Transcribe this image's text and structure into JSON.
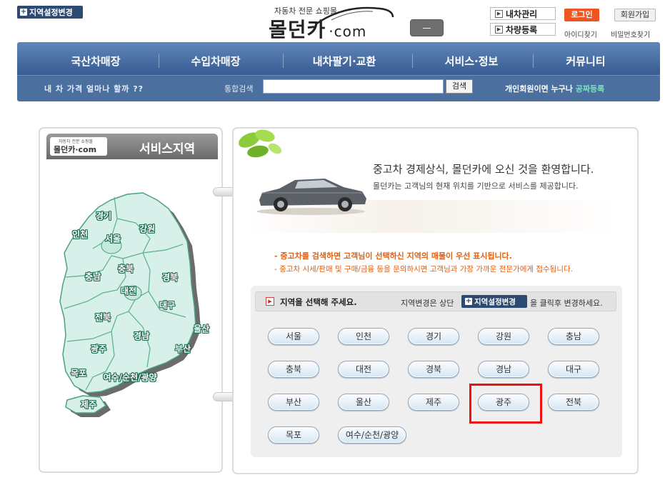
{
  "header": {
    "region_change_label": "지역설정변경",
    "logo_tagline": "자동차 전문 쇼핑몰",
    "logo_name": "몰던카",
    "logo_suffix": "·com",
    "logo_button": "—",
    "menu_my_car": "내차관리",
    "menu_register": "차량등록",
    "login": "로그인",
    "join": "회원가입",
    "find_id": "아이디찾기",
    "find_pw": "비밀번호찾기"
  },
  "nav": {
    "items": [
      "국산차매장",
      "수입차매장",
      "내차팔기·교환",
      "서비스·정보",
      "커뮤니티"
    ],
    "promo_left": "내 차 가격 얼마나 할까 ??",
    "search_label": "통합검색",
    "search_value": "",
    "search_button": "검색",
    "promo_right_prefix": "개인회원이면 누구나",
    "promo_right_highlight": "공짜등록"
  },
  "service": {
    "logo_tagline": "자동차 전문 쇼핑몰",
    "logo_name": "몰던카·com",
    "title": "서비스지역"
  },
  "map_regions": [
    {
      "name": "경기"
    },
    {
      "name": "인천"
    },
    {
      "name": "서울"
    },
    {
      "name": "강원"
    },
    {
      "name": "충남"
    },
    {
      "name": "충북"
    },
    {
      "name": "대전"
    },
    {
      "name": "경북"
    },
    {
      "name": "대구"
    },
    {
      "name": "전북"
    },
    {
      "name": "울산"
    },
    {
      "name": "경남"
    },
    {
      "name": "광주"
    },
    {
      "name": "부산"
    },
    {
      "name": "목포"
    },
    {
      "name": "여수/순천/광양"
    },
    {
      "name": "제주"
    }
  ],
  "welcome": {
    "title": "중고차 경제상식, 몰던카에 오신 것을 환영합니다.",
    "subtitle": "몰던카는 고객님의 현재 위치를 기반으로 서비스를 제공합니다."
  },
  "notices": [
    "- 중고차를 검색하면 고객님이 선택하신 지역의 매물이 우선 표시됩니다.",
    "- 중고차 시세/판매 및 구매/금융 등을 문의하시면 고객님과 가장 가까운 전문가에게 접수됩니다."
  ],
  "region_select": {
    "title": "지역을 선택해 주세요.",
    "hint_before": "지역변경은 상단",
    "hint_badge": "지역설정변경",
    "hint_after": "을 클릭후 변경하세요.",
    "buttons": [
      "서울",
      "인천",
      "경기",
      "강원",
      "충남",
      "충북",
      "대전",
      "경북",
      "경남",
      "대구",
      "부산",
      "울산",
      "제주",
      "광주",
      "전북",
      "목포",
      "여수/순천/광양"
    ],
    "highlighted": "광주"
  }
}
